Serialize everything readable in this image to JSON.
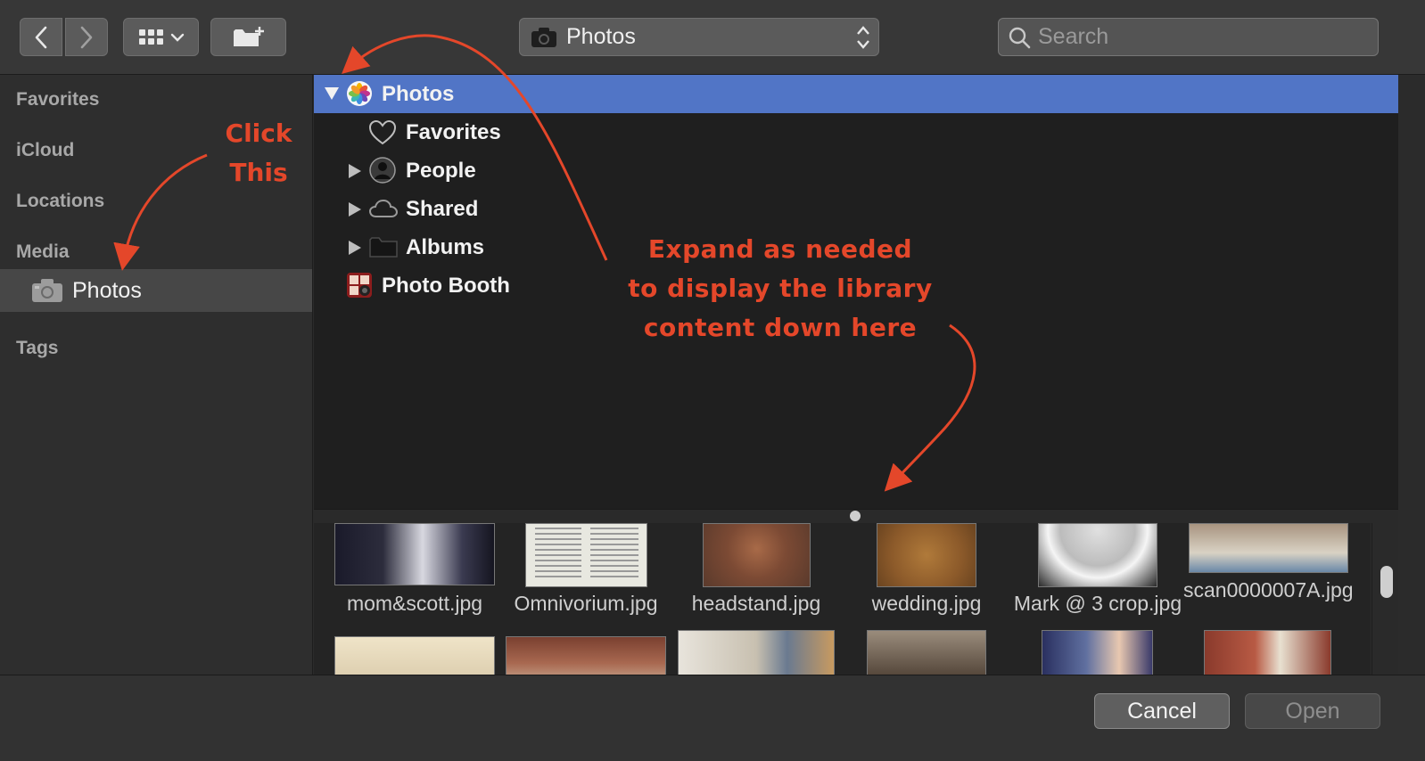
{
  "toolbar": {
    "location_label": "Photos",
    "search_placeholder": "Search"
  },
  "sidebar": {
    "sections": [
      "Favorites",
      "iCloud",
      "Locations",
      "Media",
      "Tags"
    ],
    "media_item": "Photos"
  },
  "browser": {
    "rows": [
      {
        "label": "Photos",
        "selected": true
      },
      {
        "label": "Favorites"
      },
      {
        "label": "People"
      },
      {
        "label": "Shared"
      },
      {
        "label": "Albums"
      },
      {
        "label": "Photo Booth"
      }
    ]
  },
  "thumbnails": {
    "row1": [
      "mom&scott.jpg",
      "Omnivorium.jpg",
      "headstand.jpg",
      "wedding.jpg",
      "Mark @ 3 crop.jpg",
      "scan0000007A.jpg"
    ]
  },
  "buttons": {
    "cancel": "Cancel",
    "open": "Open"
  },
  "annotations": {
    "click_line1": "Click",
    "click_line2": "This",
    "expand_line1": "Expand as needed",
    "expand_line2": "to display the library",
    "expand_line3": "content down here"
  },
  "colors": {
    "selection": "#5175c6",
    "annotation": "#e4472a"
  }
}
